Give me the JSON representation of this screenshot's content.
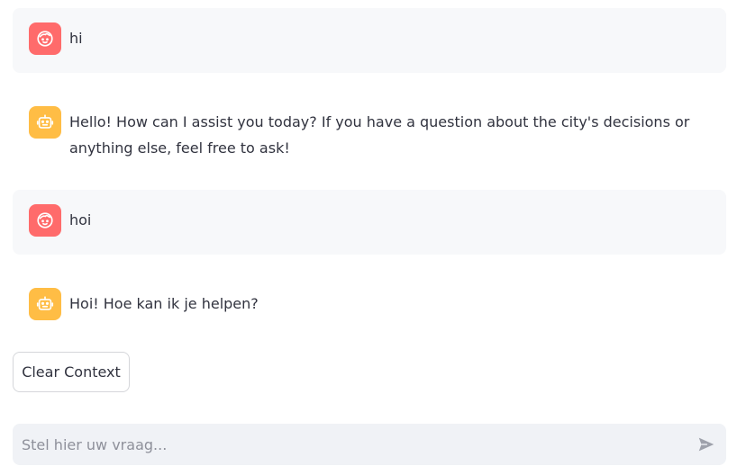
{
  "colors": {
    "user_avatar": "#ff6b6b",
    "assistant_avatar": "#ffbd45",
    "user_bubble": "#f7f8fa",
    "input_bg": "#f0f2f6",
    "text": "#31333f"
  },
  "messages": [
    {
      "role": "user",
      "icon": "face-icon",
      "text": "hi"
    },
    {
      "role": "assistant",
      "icon": "robot-icon",
      "text": "Hello! How can I assist you today? If you have a question about the city's decisions or anything else, feel free to ask!"
    },
    {
      "role": "user",
      "icon": "face-icon",
      "text": "hoi"
    },
    {
      "role": "assistant",
      "icon": "robot-icon",
      "text": "Hoi! Hoe kan ik je helpen?"
    }
  ],
  "clear_button": {
    "label": "Clear Context"
  },
  "chat_input": {
    "placeholder": "Stel hier uw vraag...",
    "value": "",
    "send_icon": "send-icon"
  }
}
